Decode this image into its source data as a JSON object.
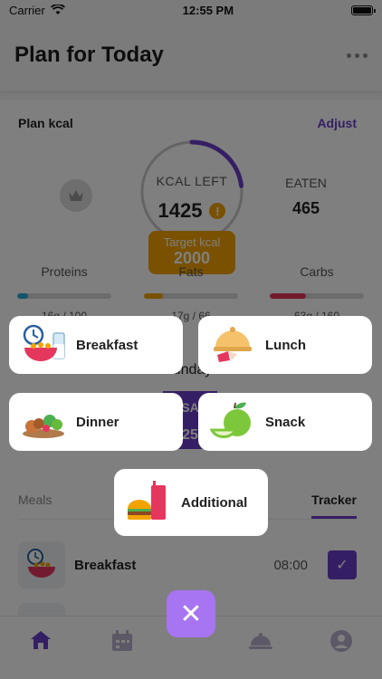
{
  "status": {
    "carrier": "Carrier",
    "time": "12:55 PM"
  },
  "header": {
    "title": "Plan for Today"
  },
  "plan": {
    "label": "Plan kcal",
    "adjust": "Adjust",
    "kcal_left_label": "KCAL LEFT",
    "kcal_left_value": "1425",
    "warning_glyph": "!",
    "target_label": "Target kcal",
    "target_value": "2000",
    "eaten_label": "EATEN",
    "eaten_value": "465",
    "ring_progress": 0.23
  },
  "macros": [
    {
      "name": "Proteins",
      "value": "16g / 100",
      "fill": 0.12,
      "color": "#2ba9d6"
    },
    {
      "name": "Fats",
      "value": "17g / 66",
      "fill": 0.2,
      "color": "#f2a300"
    },
    {
      "name": "Carbs",
      "value": "63g / 160",
      "fill": 0.38,
      "color": "#e5375e"
    }
  ],
  "day": {
    "label": "Sunday",
    "badge_top": "SA",
    "badge_bottom": "25"
  },
  "tabs": {
    "left": "Meals",
    "right": "Tracker"
  },
  "meal": {
    "name": "Breakfast",
    "time": "08:00",
    "check": "✓"
  },
  "options": {
    "breakfast": "Breakfast",
    "lunch": "Lunch",
    "dinner": "Dinner",
    "snack": "Snack",
    "additional": "Additional"
  },
  "close": {
    "glyph": "✕"
  },
  "colors": {
    "accent": "#6a3ec8",
    "close": "#a774f2",
    "orange": "#f2a300"
  }
}
